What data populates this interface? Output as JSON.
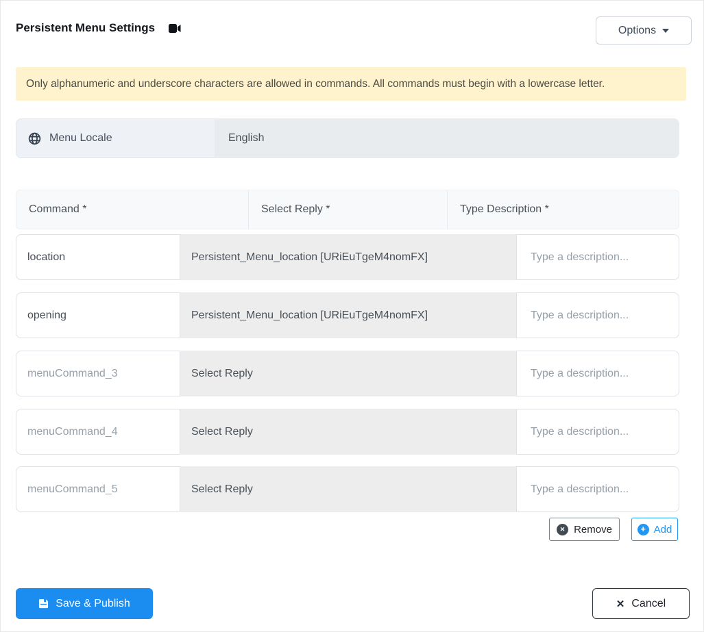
{
  "header": {
    "title": "Persistent Menu Settings",
    "options_button": "Options"
  },
  "banner": {
    "text": "Only alphanumeric and underscore characters are allowed in commands. All commands must begin with a lowercase letter."
  },
  "locale": {
    "label": "Menu Locale",
    "value": "English"
  },
  "table": {
    "columns": [
      "Command *",
      "Select Reply *",
      "Type Description *"
    ],
    "description_placeholder": "Type a description...",
    "rows": [
      {
        "command": "location",
        "reply": "Persistent_Menu_location [URiEuTgeM4nomFX]"
      },
      {
        "command": "opening",
        "reply": "Persistent_Menu_location [URiEuTgeM4nomFX]"
      },
      {
        "command": "menuCommand_3",
        "reply": "Select Reply"
      },
      {
        "command": "menuCommand_4",
        "reply": "Select Reply"
      },
      {
        "command": "menuCommand_5",
        "reply": "Select Reply"
      }
    ]
  },
  "actions": {
    "remove": "Remove",
    "add": "Add"
  },
  "footer": {
    "save": "Save & Publish",
    "cancel": "Cancel"
  },
  "icons": {
    "remove-x": "✕",
    "add-plus": "+",
    "cancel-x": "✕"
  },
  "colors": {
    "primary": "#1b8cf0",
    "add-blue": "#2196f3",
    "banner-bg": "#fff3cd",
    "banner-text": "#4c4a41",
    "header-bg": "#f8f9fb",
    "select-bg": "#ededed",
    "locale-label-bg": "#eef1f6",
    "locale-value-bg": "#e9ecef",
    "text-muted": "#97a0a9",
    "border-light": "#dee2e6"
  }
}
